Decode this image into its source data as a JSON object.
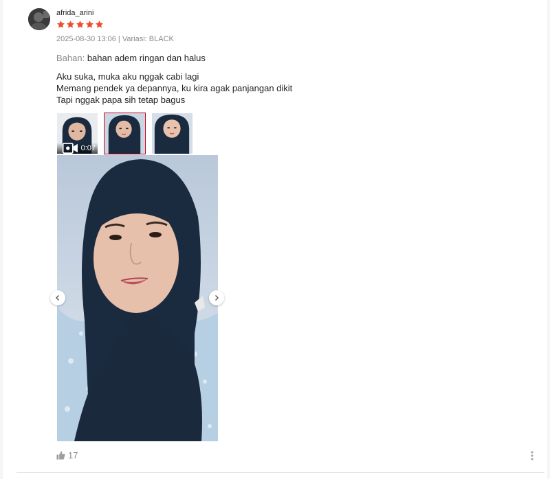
{
  "review": {
    "username": "afrida_arini",
    "rating": 5,
    "date": "2025-08-30 13:06",
    "separator": " | ",
    "variation_label": "Variasi:",
    "variation_value": "BLACK",
    "attribute_label": "Bahan:",
    "attribute_value": "bahan adem ringan dan halus",
    "text_lines": [
      "Aku suka, muka aku nggak cabi lagi",
      "Memang pendek ya depannya, ku kira agak panjangan dikit",
      "Tapi nggak papa sih tetap bagus"
    ],
    "media": {
      "video_duration": "0:07",
      "selected_index": 1,
      "thumbnail_count": 3
    },
    "like_count": "17"
  },
  "colors": {
    "star": "#ee4d2d",
    "selected_border": "#d0011b",
    "hijab": "#1b2b3f",
    "background": "#f5f5f5"
  },
  "icons": {
    "rating": "star-icon",
    "video": "video-camera-icon",
    "prev": "chevron-left-icon",
    "next": "chevron-right-icon",
    "like": "thumbs-up-icon",
    "more": "more-vertical-icon"
  }
}
